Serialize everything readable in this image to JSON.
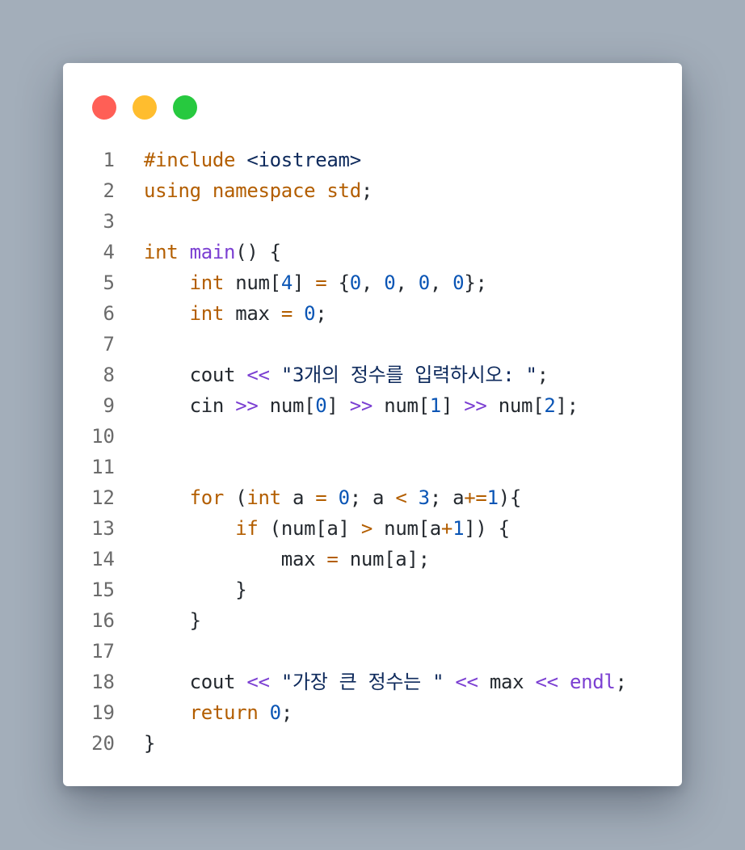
{
  "window": {
    "traffic_lights": [
      {
        "name": "close",
        "color": "#ff5f56"
      },
      {
        "name": "minimize",
        "color": "#ffbd2e"
      },
      {
        "name": "zoom",
        "color": "#27c93f"
      }
    ]
  },
  "colors": {
    "keyword": "#b35e00",
    "function": "#7b3fd2",
    "number": "#0a55b5",
    "string": "#0e2a5c",
    "plain": "#24292f",
    "line_number": "#6b6b6b",
    "background": "#a3aeba",
    "window": "#ffffff"
  },
  "code": {
    "lines": [
      {
        "n": "1",
        "tokens": [
          [
            "kw",
            "#include"
          ],
          [
            "",
            " "
          ],
          [
            "inc",
            "<iostream>"
          ]
        ]
      },
      {
        "n": "2",
        "tokens": [
          [
            "kw",
            "using"
          ],
          [
            "",
            " "
          ],
          [
            "kw",
            "namespace"
          ],
          [
            "",
            " "
          ],
          [
            "kw",
            "std"
          ],
          [
            "",
            ";"
          ]
        ]
      },
      {
        "n": "3",
        "tokens": []
      },
      {
        "n": "4",
        "tokens": [
          [
            "kw",
            "int"
          ],
          [
            "",
            " "
          ],
          [
            "fn",
            "main"
          ],
          [
            "",
            "() {"
          ]
        ]
      },
      {
        "n": "5",
        "tokens": [
          [
            "",
            "    "
          ],
          [
            "kw",
            "int"
          ],
          [
            "",
            " num["
          ],
          [
            "num",
            "4"
          ],
          [
            "",
            "] "
          ],
          [
            "eq",
            "="
          ],
          [
            "",
            " {"
          ],
          [
            "num",
            "0"
          ],
          [
            "",
            ", "
          ],
          [
            "num",
            "0"
          ],
          [
            "",
            ", "
          ],
          [
            "num",
            "0"
          ],
          [
            "",
            ", "
          ],
          [
            "num",
            "0"
          ],
          [
            "",
            "};"
          ]
        ]
      },
      {
        "n": "6",
        "tokens": [
          [
            "",
            "    "
          ],
          [
            "kw",
            "int"
          ],
          [
            "",
            " max "
          ],
          [
            "eq",
            "="
          ],
          [
            "",
            " "
          ],
          [
            "num",
            "0"
          ],
          [
            "",
            ";"
          ]
        ]
      },
      {
        "n": "7",
        "tokens": []
      },
      {
        "n": "8",
        "tokens": [
          [
            "",
            "    cout "
          ],
          [
            "op",
            "<<"
          ],
          [
            "",
            " "
          ],
          [
            "str",
            "\"3개의 정수를 입력하시오: \""
          ],
          [
            "",
            ";"
          ]
        ]
      },
      {
        "n": "9",
        "tokens": [
          [
            "",
            "    cin "
          ],
          [
            "op",
            ">>"
          ],
          [
            "",
            " num["
          ],
          [
            "num",
            "0"
          ],
          [
            "",
            "] "
          ],
          [
            "op",
            ">>"
          ],
          [
            "",
            " num["
          ],
          [
            "num",
            "1"
          ],
          [
            "",
            "] "
          ],
          [
            "op",
            ">>"
          ],
          [
            "",
            " num["
          ],
          [
            "num",
            "2"
          ],
          [
            "",
            "];"
          ]
        ]
      },
      {
        "n": "10",
        "tokens": []
      },
      {
        "n": "11",
        "tokens": []
      },
      {
        "n": "12",
        "tokens": [
          [
            "",
            "    "
          ],
          [
            "kw",
            "for"
          ],
          [
            "",
            " ("
          ],
          [
            "kw",
            "int"
          ],
          [
            "",
            " a "
          ],
          [
            "eq",
            "="
          ],
          [
            "",
            " "
          ],
          [
            "num",
            "0"
          ],
          [
            "",
            "; a "
          ],
          [
            "eq",
            "<"
          ],
          [
            "",
            " "
          ],
          [
            "num",
            "3"
          ],
          [
            "",
            "; a"
          ],
          [
            "eq",
            "+="
          ],
          [
            "num",
            "1"
          ],
          [
            "",
            "){"
          ]
        ]
      },
      {
        "n": "13",
        "tokens": [
          [
            "",
            "        "
          ],
          [
            "kw",
            "if"
          ],
          [
            "",
            " (num[a] "
          ],
          [
            "eq",
            ">"
          ],
          [
            "",
            " num[a"
          ],
          [
            "eq",
            "+"
          ],
          [
            "num",
            "1"
          ],
          [
            "",
            "]) {"
          ]
        ]
      },
      {
        "n": "14",
        "tokens": [
          [
            "",
            "            max "
          ],
          [
            "eq",
            "="
          ],
          [
            "",
            " num[a];"
          ]
        ]
      },
      {
        "n": "15",
        "tokens": [
          [
            "",
            "        }"
          ]
        ]
      },
      {
        "n": "16",
        "tokens": [
          [
            "",
            "    }"
          ]
        ]
      },
      {
        "n": "17",
        "tokens": []
      },
      {
        "n": "18",
        "tokens": [
          [
            "",
            "    cout "
          ],
          [
            "op",
            "<<"
          ],
          [
            "",
            " "
          ],
          [
            "str",
            "\"가장 큰 정수는 \""
          ],
          [
            "",
            " "
          ],
          [
            "op",
            "<<"
          ],
          [
            "",
            " max "
          ],
          [
            "op",
            "<<"
          ],
          [
            "",
            " "
          ],
          [
            "fn",
            "endl"
          ],
          [
            "",
            ";"
          ]
        ]
      },
      {
        "n": "19",
        "tokens": [
          [
            "",
            "    "
          ],
          [
            "kw",
            "return"
          ],
          [
            "",
            " "
          ],
          [
            "num",
            "0"
          ],
          [
            "",
            ";"
          ]
        ]
      },
      {
        "n": "20",
        "tokens": [
          [
            "",
            "}"
          ]
        ]
      }
    ]
  }
}
